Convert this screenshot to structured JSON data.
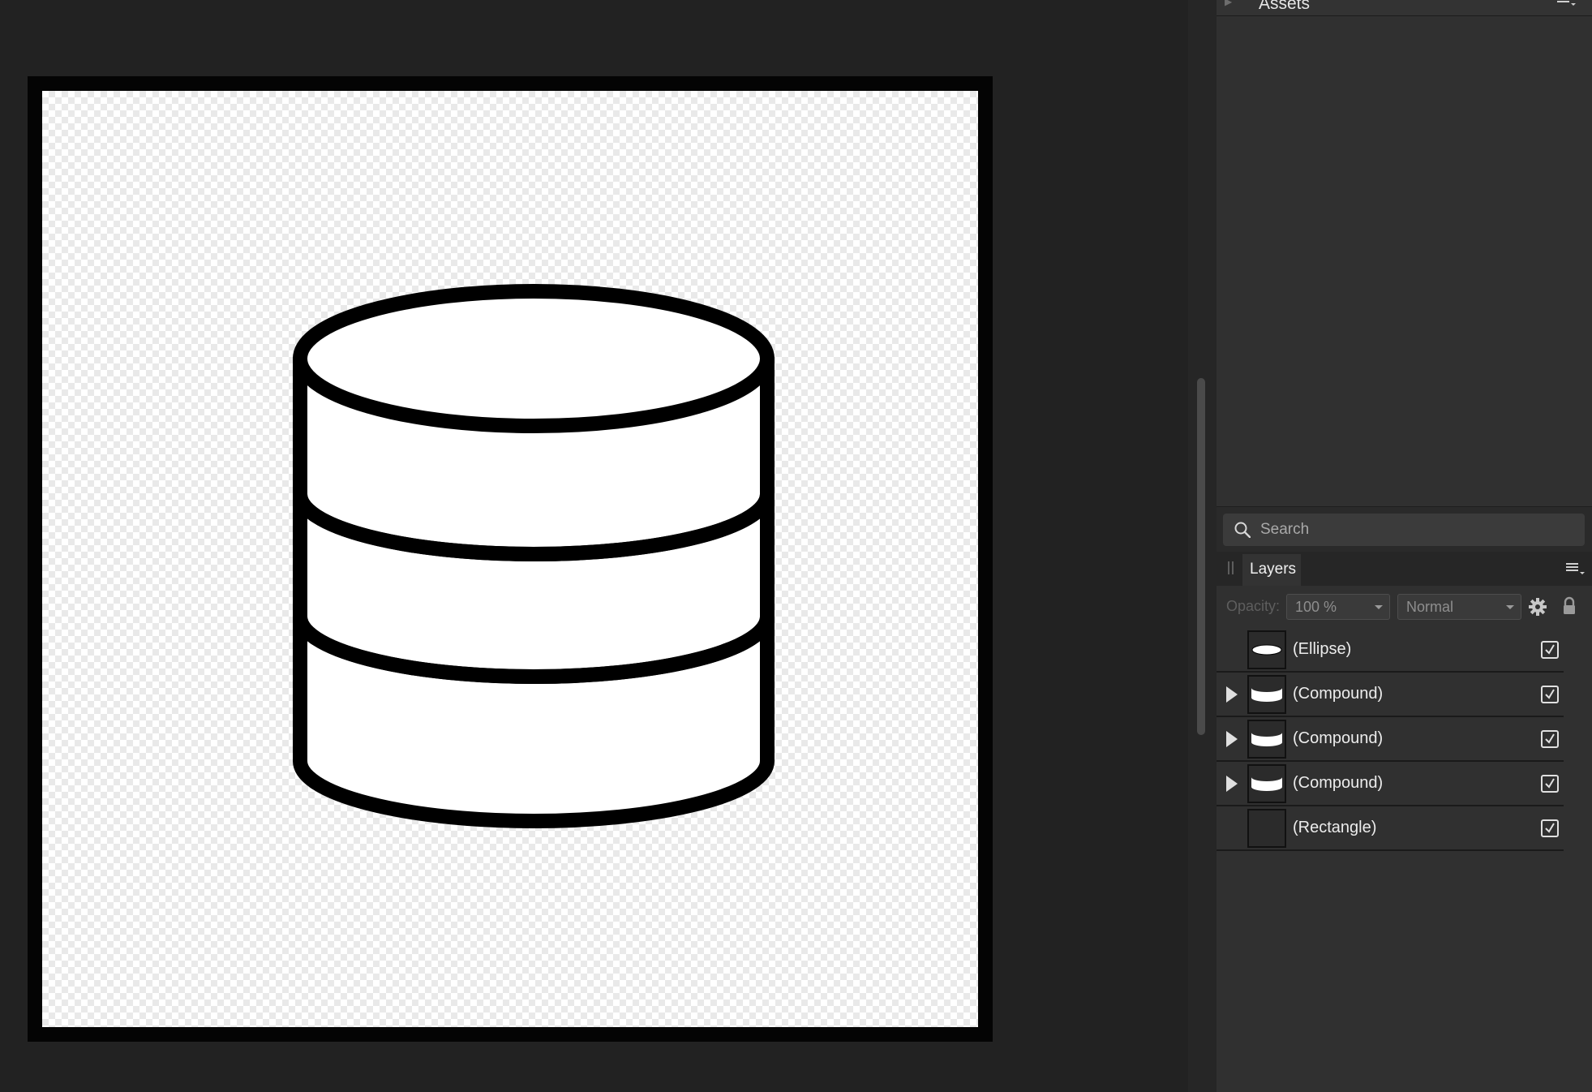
{
  "assets_panel": {
    "title": "Assets",
    "menu_icon": "panel-menu-icon",
    "search": {
      "placeholder": "Search",
      "icon": "search-icon"
    }
  },
  "layers_panel": {
    "tab_label": "Layers",
    "menu_icon": "panel-menu-icon",
    "opacity_label": "Opacity:",
    "opacity_value": "100 %",
    "blend_mode": "Normal",
    "settings_icon": "gear-icon",
    "lock_icon": "lock-icon",
    "layers": [
      {
        "name": "(Ellipse)",
        "expandable": false,
        "visible": true,
        "thumb": "ellipse"
      },
      {
        "name": "(Compound)",
        "expandable": true,
        "visible": true,
        "thumb": "band"
      },
      {
        "name": "(Compound)",
        "expandable": true,
        "visible": true,
        "thumb": "band"
      },
      {
        "name": "(Compound)",
        "expandable": true,
        "visible": true,
        "thumb": "band"
      },
      {
        "name": "(Rectangle)",
        "expandable": false,
        "visible": true,
        "thumb": "empty"
      }
    ]
  },
  "colors": {
    "canvas_bg": "#222222",
    "panel_bg": "#303030",
    "artboard_border": "#040404",
    "artwork_stroke": "#000000",
    "artwork_fill": "#ffffff"
  }
}
